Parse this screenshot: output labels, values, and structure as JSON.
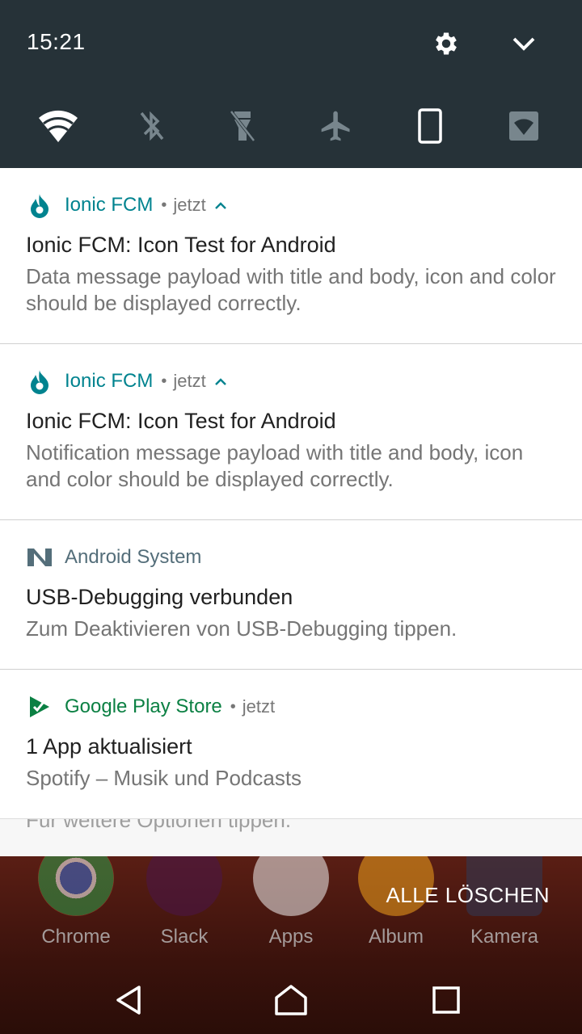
{
  "status": {
    "time": "15:21"
  },
  "colors": {
    "header_bg": "#263238",
    "ionic_accent": "#00838F",
    "android_system": "#546E7A",
    "play_green": "#0B8043"
  },
  "quick_settings": [
    {
      "name": "wifi-icon",
      "state": "on"
    },
    {
      "name": "bluetooth-off-icon",
      "state": "off"
    },
    {
      "name": "flashlight-off-icon",
      "state": "off"
    },
    {
      "name": "airplane-mode-icon",
      "state": "off"
    },
    {
      "name": "portrait-rotation-icon",
      "state": "on"
    },
    {
      "name": "hotspot-icon",
      "state": "off"
    }
  ],
  "notifications": [
    {
      "app": "Ionic FCM",
      "when": "jetzt",
      "title": "Ionic FCM: Icon Test for Android",
      "body": "Data message payload with title and body, icon and color should be displayed correctly."
    },
    {
      "app": "Ionic FCM",
      "when": "jetzt",
      "title": "Ionic FCM: Icon Test for Android",
      "body": "Notification message payload with title and body, icon and color should be displayed correctly."
    },
    {
      "app": "Android System",
      "title": "USB-Debugging verbunden",
      "body": "Zum Deaktivieren von USB-Debugging tippen."
    },
    {
      "app": "Google Play Store",
      "when": "jetzt",
      "title": "1 App aktualisiert",
      "body": "Spotify – Musik und Podcasts"
    }
  ],
  "peek_text": "Für weitere Optionen tippen.",
  "clear_all": "ALLE LÖSCHEN",
  "dock": [
    {
      "label": "Chrome"
    },
    {
      "label": "Slack"
    },
    {
      "label": "Apps"
    },
    {
      "label": "Album"
    },
    {
      "label": "Kamera"
    }
  ]
}
